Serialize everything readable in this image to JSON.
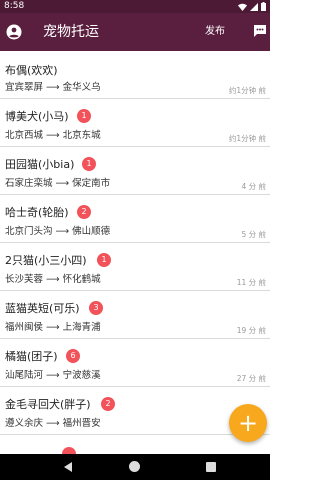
{
  "status": {
    "time": "8:58"
  },
  "app_bar": {
    "title": "宠物托运",
    "publish_label": "发布"
  },
  "items": [
    {
      "title": "布偶(欢欢)",
      "badge": "",
      "route": "宜宾翠屏 ⟶ 金华义乌",
      "time": "约1分钟 前"
    },
    {
      "title": "博美犬(小马)",
      "badge": "1",
      "route": "北京西城 ⟶ 北京东城",
      "time": "约1分钟 前"
    },
    {
      "title": "田园猫(小bia)",
      "badge": "1",
      "route": "石家庄栾城 ⟶ 保定南市",
      "time": "4 分 前"
    },
    {
      "title": "哈士奇(轮胎)",
      "badge": "2",
      "route": "北京门头沟 ⟶ 佛山顺德",
      "time": "5 分 前"
    },
    {
      "title": "2只猫(小三小四)",
      "badge": "1",
      "route": "长沙芙蓉 ⟶ 怀化鹤城",
      "time": "11 分 前"
    },
    {
      "title": "蓝猫英短(可乐)",
      "badge": "3",
      "route": "福州闽侯 ⟶ 上海青浦",
      "time": "19 分 前"
    },
    {
      "title": "橘猫(团子)",
      "badge": "6",
      "route": "汕尾陆河 ⟶ 宁波慈溪",
      "time": "27 分 前"
    },
    {
      "title": "金毛寻回犬(胖子)",
      "badge": "2",
      "route": "遵义余庆 ⟶ 福州晋安",
      "time": ""
    }
  ],
  "fab": {
    "label": "+"
  },
  "icons": {
    "account": "account-circle-icon",
    "chat": "chat-icon",
    "wifi": "wifi-icon",
    "signal": "signal-icon",
    "battery": "battery-icon"
  },
  "colors": {
    "app_bar": "#5a1f3f",
    "badge": "#f25259",
    "fab": "#f7a81d"
  }
}
